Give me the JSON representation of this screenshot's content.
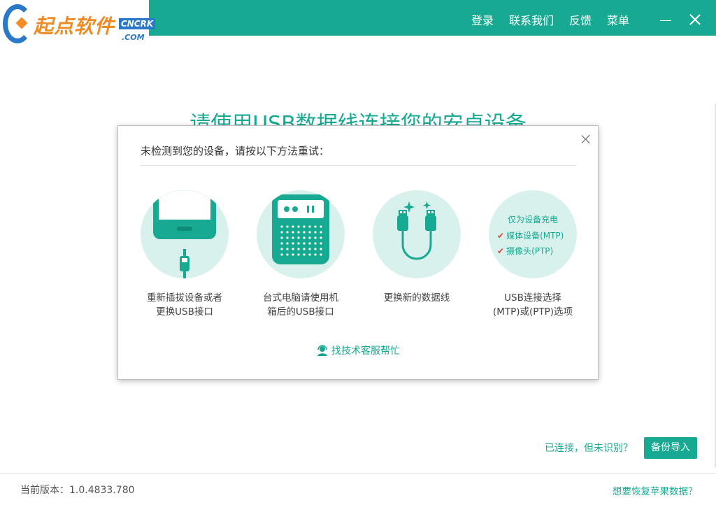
{
  "brand": {
    "logo_text": "起点软件",
    "badge_top": "CNCRK",
    "badge_bottom": ".COM"
  },
  "header": {
    "nav": [
      "登录",
      "联系我们",
      "反馈",
      "菜单"
    ]
  },
  "main": {
    "title": "请使用USB数据线连接您的安卓设备"
  },
  "dialog": {
    "heading": "未检测到您的设备，请按以下方法重试：",
    "options": [
      {
        "label_line1": "重新插拔设备或者",
        "label_line2": "更换USB接口",
        "icon": "phone-usb-icon"
      },
      {
        "label_line1": "台式电脑请使用机",
        "label_line2": "箱后的USB接口",
        "icon": "desktop-case-icon"
      },
      {
        "label_line1": "更换新的数据线",
        "label_line2": "",
        "icon": "usb-cable-icon"
      },
      {
        "label_line1": "USB连接选择",
        "label_line2": "(MTP)或(PTP)选项",
        "icon": "usb-mode-icon"
      }
    ],
    "mode_panel": {
      "title": "仅为设备充电",
      "mtp": "媒体设备(MTP)",
      "ptp": "摄像头(PTP)"
    },
    "help_link": "找技术客服帮忙"
  },
  "footer": {
    "connected_link": "已连接，但未识别？",
    "import_button": "备份导入",
    "version": "当前版本：1.0.4833.780",
    "recover_link": "想要恢复苹果数据？"
  },
  "colors": {
    "accent": "#17a992",
    "circle_bg": "#d9f1ec",
    "check": "#e0403a"
  }
}
